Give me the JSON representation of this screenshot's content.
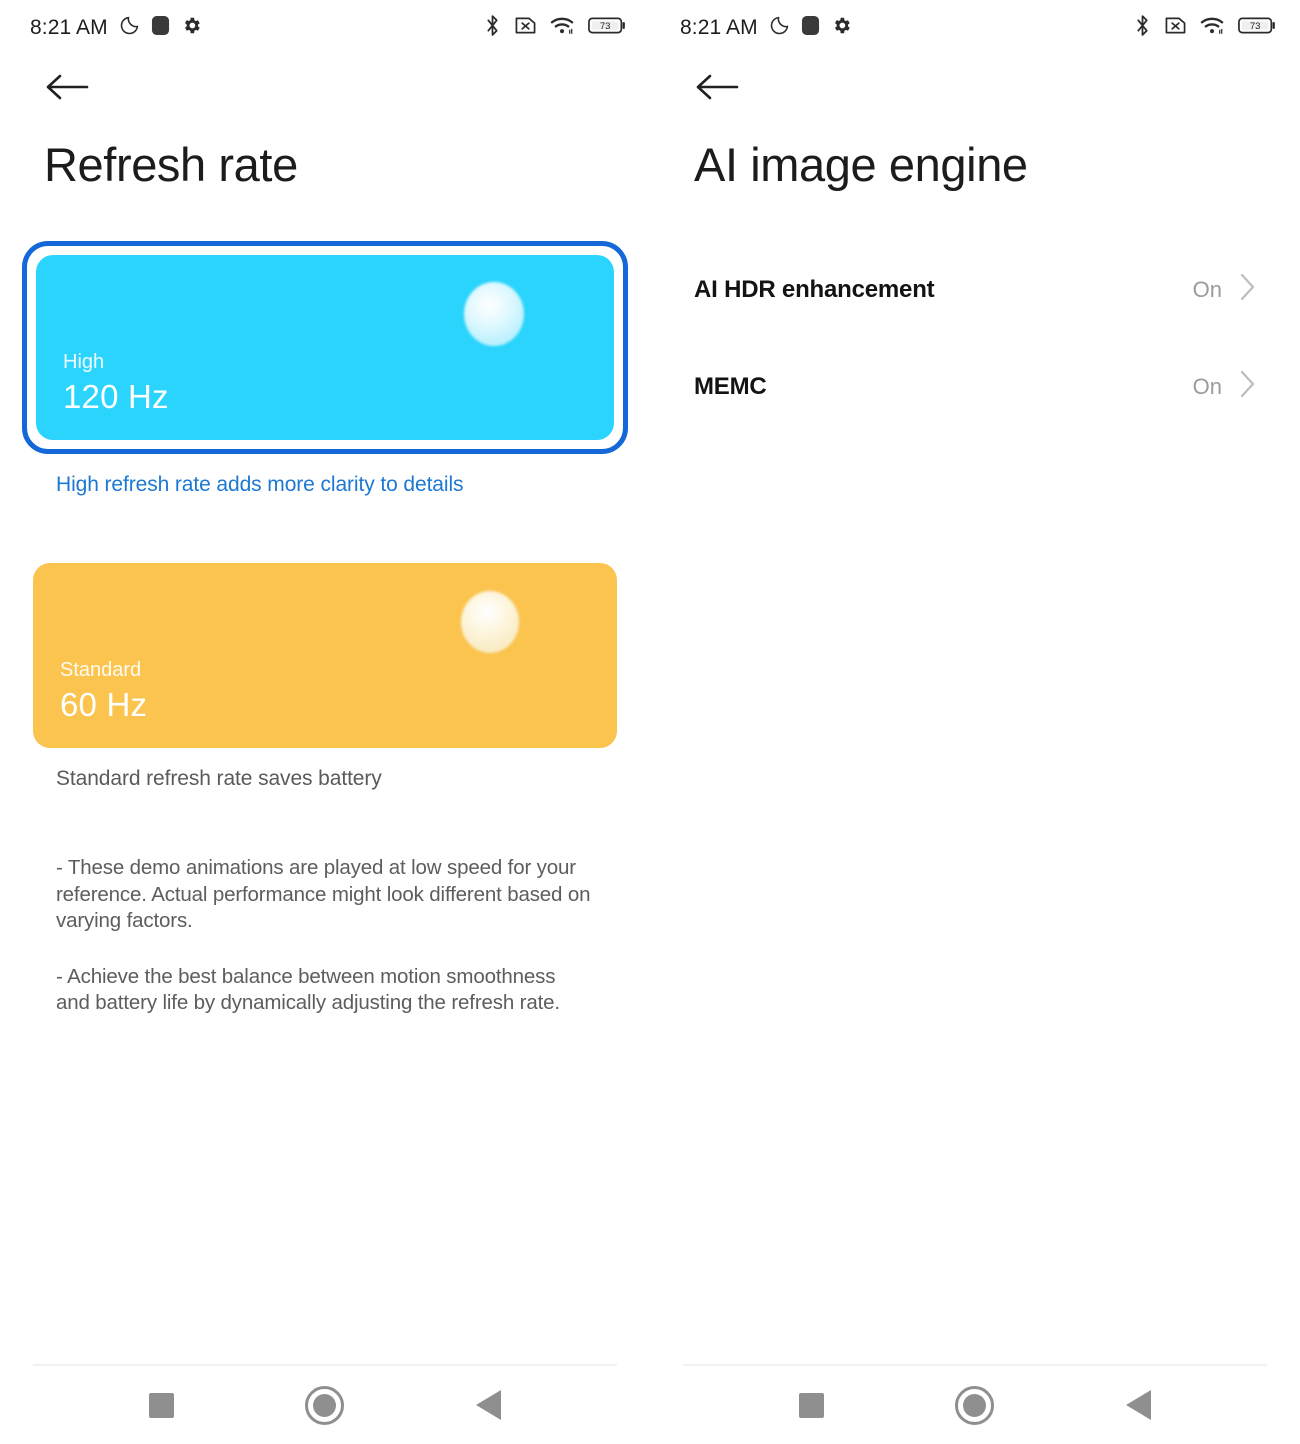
{
  "status_bar": {
    "time": "8:21 AM",
    "left_icons": [
      "dnd-moon-icon",
      "notification-square-icon",
      "gear-icon"
    ],
    "right_icons": [
      "bluetooth-icon",
      "no-sim-icon",
      "wifi-icon",
      "battery-icon"
    ],
    "battery_level": "73"
  },
  "left_screen": {
    "back_label": "Back",
    "title": "Refresh rate",
    "options": [
      {
        "name": "High",
        "value": "120 Hz",
        "caption": "High refresh rate adds more clarity to details",
        "selected": true,
        "color": "#2ad4fd",
        "caption_color": "#1c78d4"
      },
      {
        "name": "Standard",
        "value": "60 Hz",
        "caption": "Standard refresh rate saves battery",
        "selected": false,
        "color": "#fbc44e",
        "caption_color": "#5a5a5a"
      }
    ],
    "notes": [
      "- These demo animations are played at low speed for your reference. Actual performance might look different based on varying factors.",
      "- Achieve the best balance between motion smoothness and battery life by dynamically adjusting the refresh rate."
    ],
    "selection_ring_color": "#1468d8"
  },
  "right_screen": {
    "back_label": "Back",
    "title": "AI image engine",
    "rows": [
      {
        "label": "AI HDR enhancement",
        "value": "On"
      },
      {
        "label": "MEMC",
        "value": "On"
      }
    ]
  },
  "nav_bar": {
    "recents_label": "Recents",
    "home_label": "Home",
    "back_label": "Back"
  }
}
